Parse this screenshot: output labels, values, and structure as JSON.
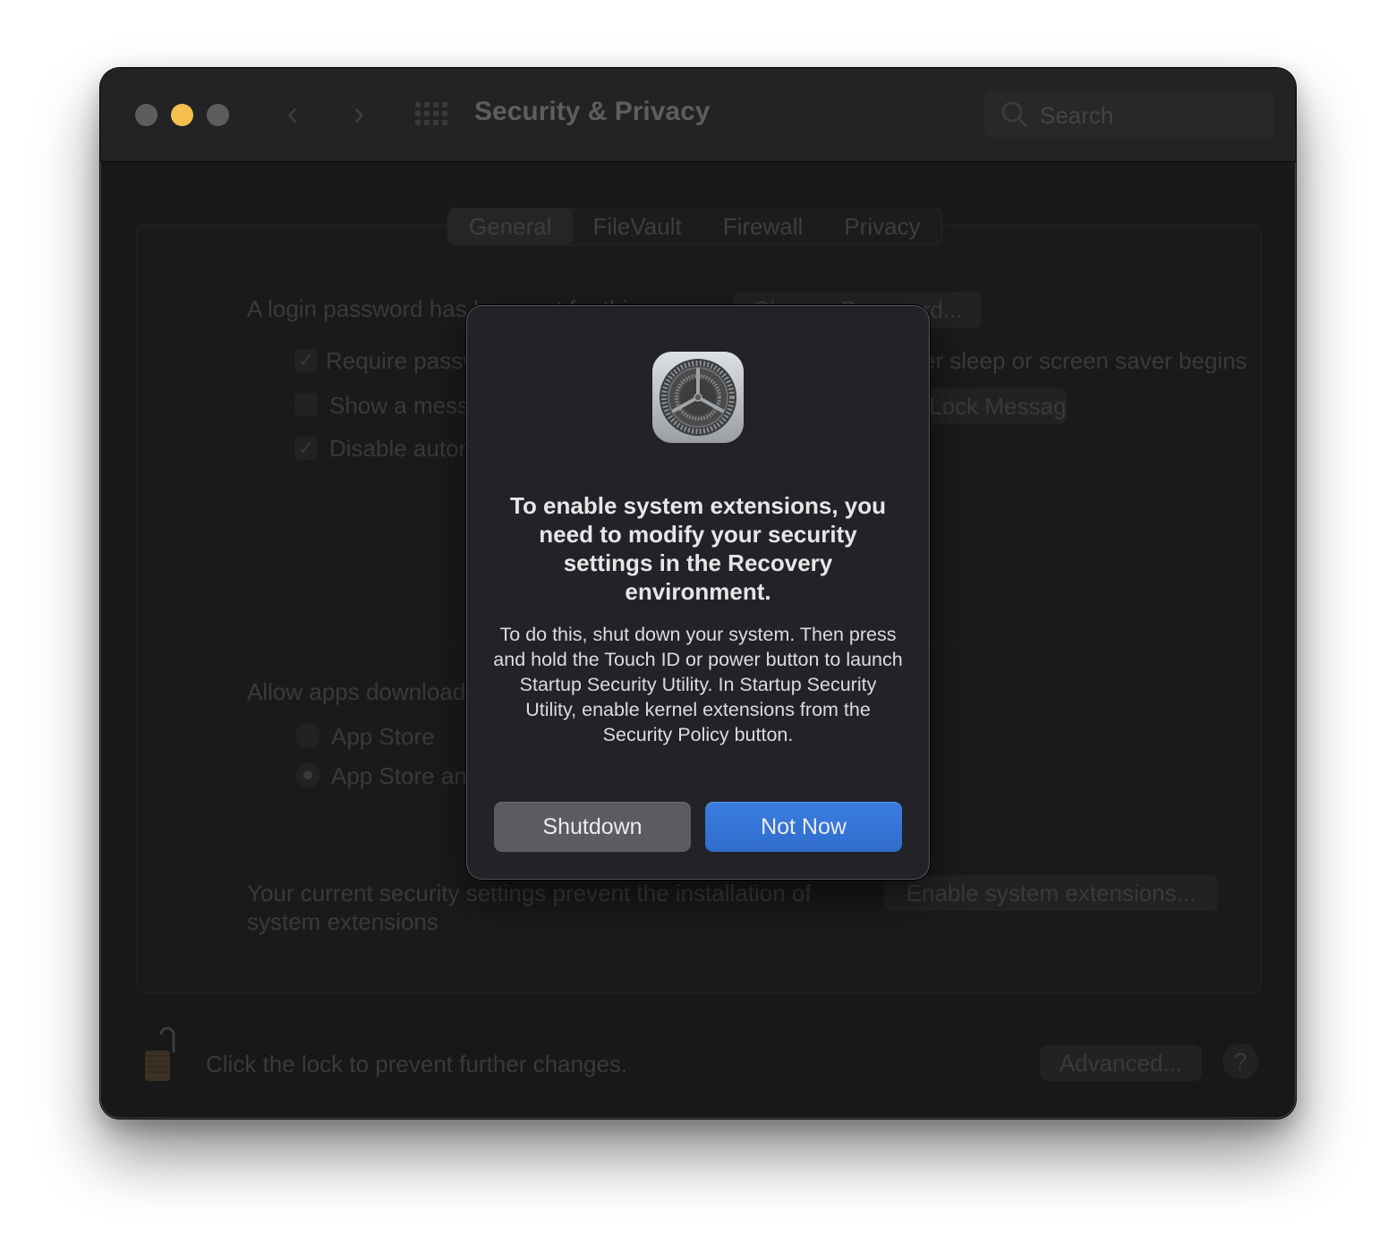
{
  "window": {
    "title": "Security & Privacy",
    "search_placeholder": "Search",
    "traffic_colors": {
      "close": "#5d5d60",
      "minimize": "#f4bf4f",
      "zoom": "#5d5d60"
    }
  },
  "tabs": [
    {
      "label": "General",
      "active": true
    },
    {
      "label": "FileVault",
      "active": false
    },
    {
      "label": "Firewall",
      "active": false
    },
    {
      "label": "Privacy",
      "active": false
    }
  ],
  "general": {
    "login_password_text": "A login password has been set for this user",
    "change_password_button": "Change Password...",
    "require_password": {
      "label": "Require password",
      "suffix": "after sleep or screen saver begins",
      "checked": true
    },
    "show_message": {
      "label": "Show a message when the screen is locked",
      "checked": false
    },
    "set_lock_message_button": "Set Lock Message...",
    "disable_auto_login": {
      "label": "Disable automatic login",
      "checked": true
    },
    "allow_apps_label": "Allow apps downloaded from:",
    "radio_options": [
      {
        "label": "App Store",
        "selected": false
      },
      {
        "label": "App Store and identified developers",
        "selected": true
      }
    ],
    "extensions_text": "Your current security settings prevent the installation of system extensions",
    "enable_extensions_button": "Enable system extensions..."
  },
  "footer": {
    "lock_text": "Click the lock to prevent further changes.",
    "advanced_button": "Advanced...",
    "help_label": "?"
  },
  "dialog": {
    "icon": "system-preferences-gear-icon",
    "title": "To enable system extensions, you need to modify your security settings in the Recovery environment.",
    "body": "To do this, shut down your system. Then press and hold the Touch ID or power button to launch Startup Security Utility. In Startup Security Utility, enable kernel extensions from the Security Policy button.",
    "buttons": {
      "shutdown": "Shutdown",
      "not_now": "Not Now"
    },
    "accent_color": "#3478e0"
  }
}
